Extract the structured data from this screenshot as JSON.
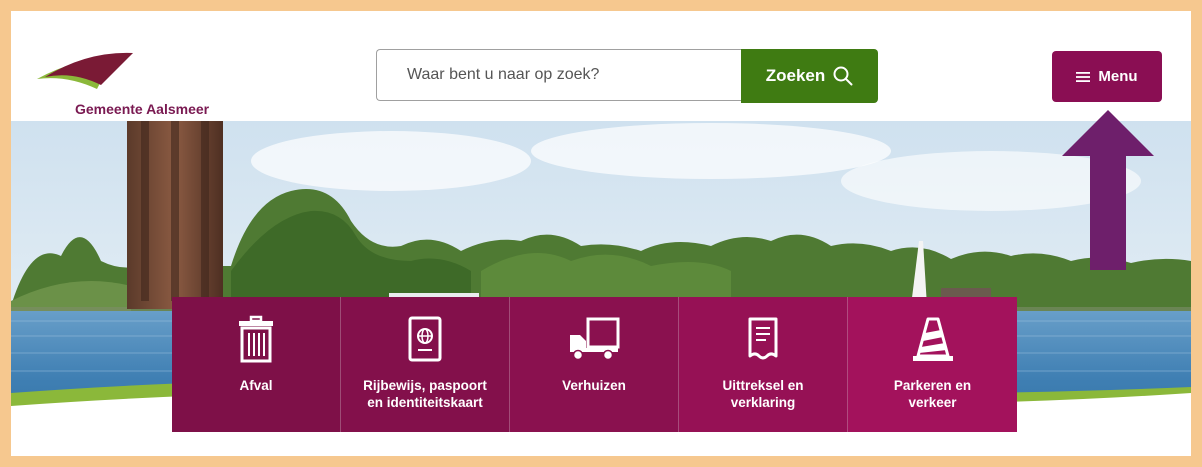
{
  "header": {
    "logo_text": "Gemeente Aalsmeer",
    "search_placeholder": "Waar bent u naar op zoek?",
    "search_button_label": "Zoeken",
    "menu_button_label": "Menu"
  },
  "tiles": [
    {
      "label": "Afval",
      "icon": "trash-icon"
    },
    {
      "label": "Rijbewijs, paspoort\nen identiteitskaart",
      "icon": "passport-icon"
    },
    {
      "label": "Verhuizen",
      "icon": "truck-icon"
    },
    {
      "label": "Uittreksel en\nverklaring",
      "icon": "document-icon"
    },
    {
      "label": "Parkeren en\nverkeer",
      "icon": "traffic-cone-icon"
    }
  ],
  "colors": {
    "frame": "#f6c88f",
    "brand_purple": "#8a0e53",
    "search_green": "#3f7b12",
    "arrow_purple": "#6e1f6b"
  }
}
